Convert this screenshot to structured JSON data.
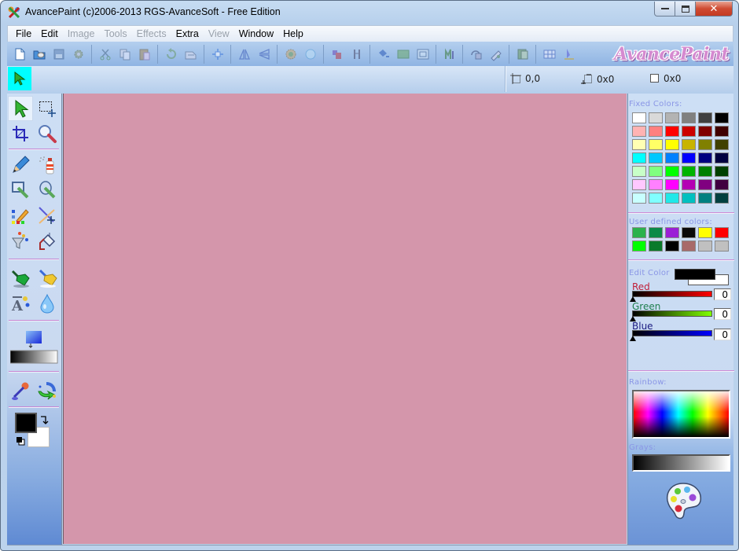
{
  "window": {
    "title": "AvancePaint (c)2006-2013 RGS-AvanceSoft - Free Edition",
    "app_icon": "avancepaint-app-icon",
    "controls": [
      "minimize",
      "maximize",
      "close"
    ]
  },
  "menubar": {
    "items": [
      {
        "label": "File",
        "enabled": true
      },
      {
        "label": "Edit",
        "enabled": true
      },
      {
        "label": "Image",
        "enabled": false
      },
      {
        "label": "Tools",
        "enabled": false
      },
      {
        "label": "Effects",
        "enabled": false
      },
      {
        "label": "Extra",
        "enabled": true
      },
      {
        "label": "View",
        "enabled": false
      },
      {
        "label": "Window",
        "enabled": true
      },
      {
        "label": "Help",
        "enabled": true
      }
    ]
  },
  "toolbar": {
    "groups": [
      [
        "new-file",
        "open-file",
        "save-file",
        "settings"
      ],
      [
        "cut",
        "copy",
        "paste"
      ],
      [
        "undo",
        "redo"
      ],
      [
        "move"
      ],
      [
        "flip-horizontal",
        "flip-vertical"
      ],
      [
        "adjust-colors",
        "circle-effect"
      ],
      [
        "resize-image",
        "rotate"
      ],
      [
        "fill-tool",
        "image-frame",
        "screen-frame"
      ],
      [
        "effects"
      ],
      [
        "stamp-tool",
        "brush-stamp"
      ],
      [
        "layers"
      ],
      [
        "grid",
        "measure"
      ]
    ],
    "logo": "AvancePaint"
  },
  "options_bar": {
    "active_tool": "select-arrow",
    "position": "0,0",
    "selection_size": "0x0",
    "image_size": "0x0"
  },
  "tools": {
    "group1": [
      "select-arrow",
      "rect-select",
      "crop",
      "zoom"
    ],
    "group2": [
      "pencil",
      "spray-can",
      "rectangle-draw",
      "ellipse-draw",
      "color-pencil",
      "line-draw",
      "color-filter",
      "paint-bucket"
    ],
    "group3": [
      "brush-green",
      "brush-yellow",
      "text-tool",
      "water-drop"
    ],
    "group4": [
      "gradient"
    ],
    "group5": [
      "eyedropper",
      "replace-color"
    ],
    "selected": "select-arrow",
    "foreground_color": "#000000",
    "background_color": "#ffffff"
  },
  "canvas": {
    "color": "#d496ab"
  },
  "colors_panel": {
    "fixed_label": "Fixed Colors:",
    "fixed_colors": [
      "#ffffff",
      "#d9d9d9",
      "#b3b3b3",
      "#808080",
      "#404040",
      "#000000",
      "#ffb3b3",
      "#ff8080",
      "#ff0000",
      "#cc0000",
      "#800000",
      "#400000",
      "#ffffb3",
      "#ffff66",
      "#ffff00",
      "#c8b400",
      "#808000",
      "#404000",
      "#00ffff",
      "#00c8ff",
      "#0080ff",
      "#0000ff",
      "#000080",
      "#000040",
      "#c8ffc8",
      "#80ff80",
      "#00ff00",
      "#00b400",
      "#008000",
      "#004000",
      "#ffc8ff",
      "#ff80ff",
      "#ff00ff",
      "#b400b4",
      "#800080",
      "#400040",
      "#c8ffff",
      "#80ffff",
      "#20e8e8",
      "#00c0c0",
      "#008080",
      "#004040"
    ],
    "user_label": "User defined colors:",
    "user_colors": [
      "#2bb24c",
      "#0a8a48",
      "#9b1fd6",
      "#0a0a0a",
      "#ffff00",
      "#ff0000",
      "#00ff00",
      "#0a7a2a",
      "#000000",
      "#a86a6a",
      "#c0c0c0",
      "#c0c0c0"
    ],
    "edit_label": "Edit Color",
    "edit_fg": "#000000",
    "edit_bg": "#ffffff",
    "sliders": [
      {
        "label": "Red",
        "value": "0",
        "color": "#ff0000",
        "label_color": "#c0203a"
      },
      {
        "label": "Green",
        "value": "0",
        "color": "#80ff00",
        "label_color": "#208050"
      },
      {
        "label": "Blue",
        "value": "0",
        "color": "#0000ff",
        "label_color": "#1a1a80"
      }
    ],
    "rainbow_label": "Rainbow:",
    "grays_label": "Grays:"
  }
}
